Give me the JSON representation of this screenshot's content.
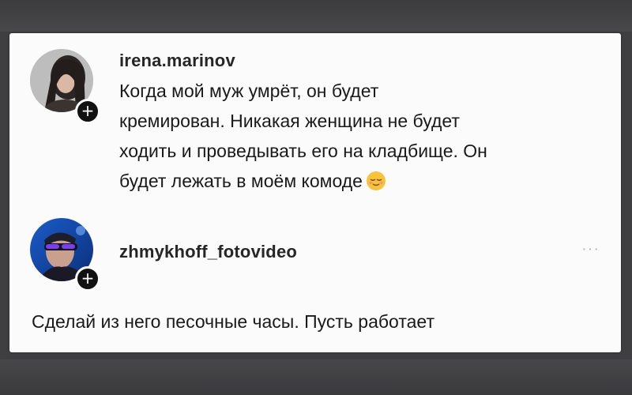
{
  "comment1": {
    "username": "irena.marinov",
    "lines": [
      "Когда мой муж умрёт, он будет",
      "кремирован. Никакая женщина не будет",
      "ходить и проведывать его на кладбище. Он",
      "будет лежать в моём комоде"
    ],
    "emoji": "relieved-face-emoji"
  },
  "comment2": {
    "username": "zhmykhoff_fotovideo",
    "more_label": "···",
    "text": "Сделай из него песочные часы. Пусть работает"
  },
  "follow_badge_label": "+",
  "colors": {
    "text": "#1a1a1a",
    "username": "#262626",
    "card": "#fbfbfb",
    "frame": "#3f3f42",
    "badge": "#111111"
  }
}
